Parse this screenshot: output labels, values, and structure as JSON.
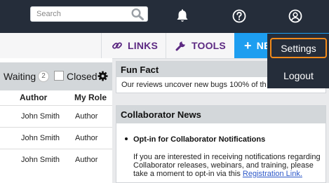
{
  "header": {
    "search_placeholder": "Search",
    "icons": [
      "search-icon",
      "bell-icon",
      "help-icon",
      "user-icon"
    ]
  },
  "toolbar": {
    "links_label": "LINKS",
    "tools_label": "TOOLS",
    "new_label": "NE",
    "colors": {
      "accent_text": "#5d2a83",
      "new_button": "#1d9ef0"
    }
  },
  "filter": {
    "waiting_label": "Waiting",
    "waiting_count": "2",
    "closed_label": "Closed"
  },
  "table": {
    "columns": [
      "Author",
      "My Role"
    ],
    "rows": [
      {
        "author": "John Smith",
        "role": "Author"
      },
      {
        "author": "John Smith",
        "role": "Author"
      },
      {
        "author": "John Smith",
        "role": "Author"
      }
    ]
  },
  "fun_fact": {
    "title": "Fun Fact",
    "text": "Our reviews uncover new bugs 100% of th"
  },
  "news": {
    "title": "Collaborator News",
    "item_title": "Opt-in for Collaborator Notifications",
    "item_text": "If you are interested in receiving notifications regarding Collaborator releases, webinars, and training, please take a moment to opt-in via this ",
    "link_text": "Registration Link."
  },
  "user_menu": {
    "settings_label": "Settings",
    "logout_label": "Logout",
    "highlight_color": "#f28a1a"
  }
}
